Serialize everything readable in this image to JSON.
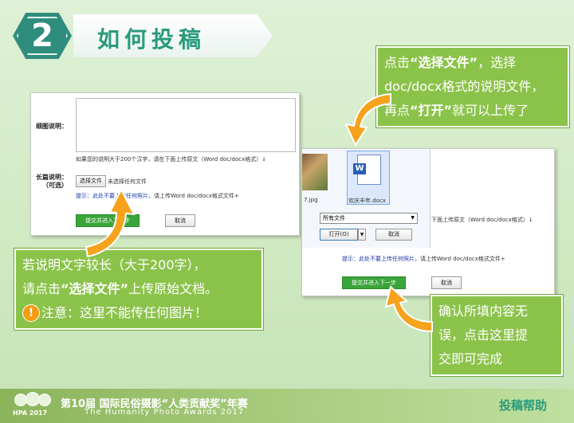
{
  "header": {
    "step_number": "2",
    "title": "如何投稿"
  },
  "callout_top": {
    "line1_pre": "点击",
    "line1_hl": "“选择文件”",
    "line1_post": "，选择",
    "line2": "doc/docx格式的说明文件，",
    "line3_pre": "再点",
    "line3_hl": "“打开”",
    "line3_post": "就可以上传了"
  },
  "callout_left": {
    "line1": "若说明文字较长（大于200字），",
    "line2_pre": "请点击",
    "line2_hl": "“选择文件”",
    "line2_post": "上传原始文档。",
    "line3": "注意：这里不能传任何图片！"
  },
  "callout_right": {
    "line1": "确认所填内容无",
    "line2": "误，点击这里提",
    "line3": "交即可完成"
  },
  "form_left": {
    "desc_label": "细图说明：",
    "desc_hint": "如果您的说明大于200个汉字，请在下面上传原文（Word doc/docx格式）↓",
    "long_label": "长篇说明：",
    "long_label_sub": "（可选）",
    "choose_file_btn": "选择文件",
    "no_file_text": "未选择任何文件",
    "tip_blue": "提示：此处不要上传任何照片，",
    "tip_grey": "请上传Word doc/docx格式文件+",
    "submit_btn": "提交并进入下一步",
    "cancel_btn": "取消"
  },
  "form_right": {
    "thumb_name": "7.jpg",
    "doc_name": "欢庆丰年.docx",
    "file_type": "所有文件",
    "open_btn": "打开(O)",
    "cancel_btn": "取消",
    "hint": "下面上传原文（Word doc/docx格式）↓",
    "tip_blue": "提示：此处不要上传任何照片，",
    "tip_grey": "请上传Word doc/docx格式文件+",
    "submit_btn": "提交并进入下一步",
    "cancel_btn2": "取消"
  },
  "footer": {
    "logo_text": "HPA 2017",
    "title": "第10届 国际民俗摄影“人类贡献奖”年赛",
    "subtitle": "The Humanity Photo Awards 2017",
    "help": "投稿帮助"
  }
}
